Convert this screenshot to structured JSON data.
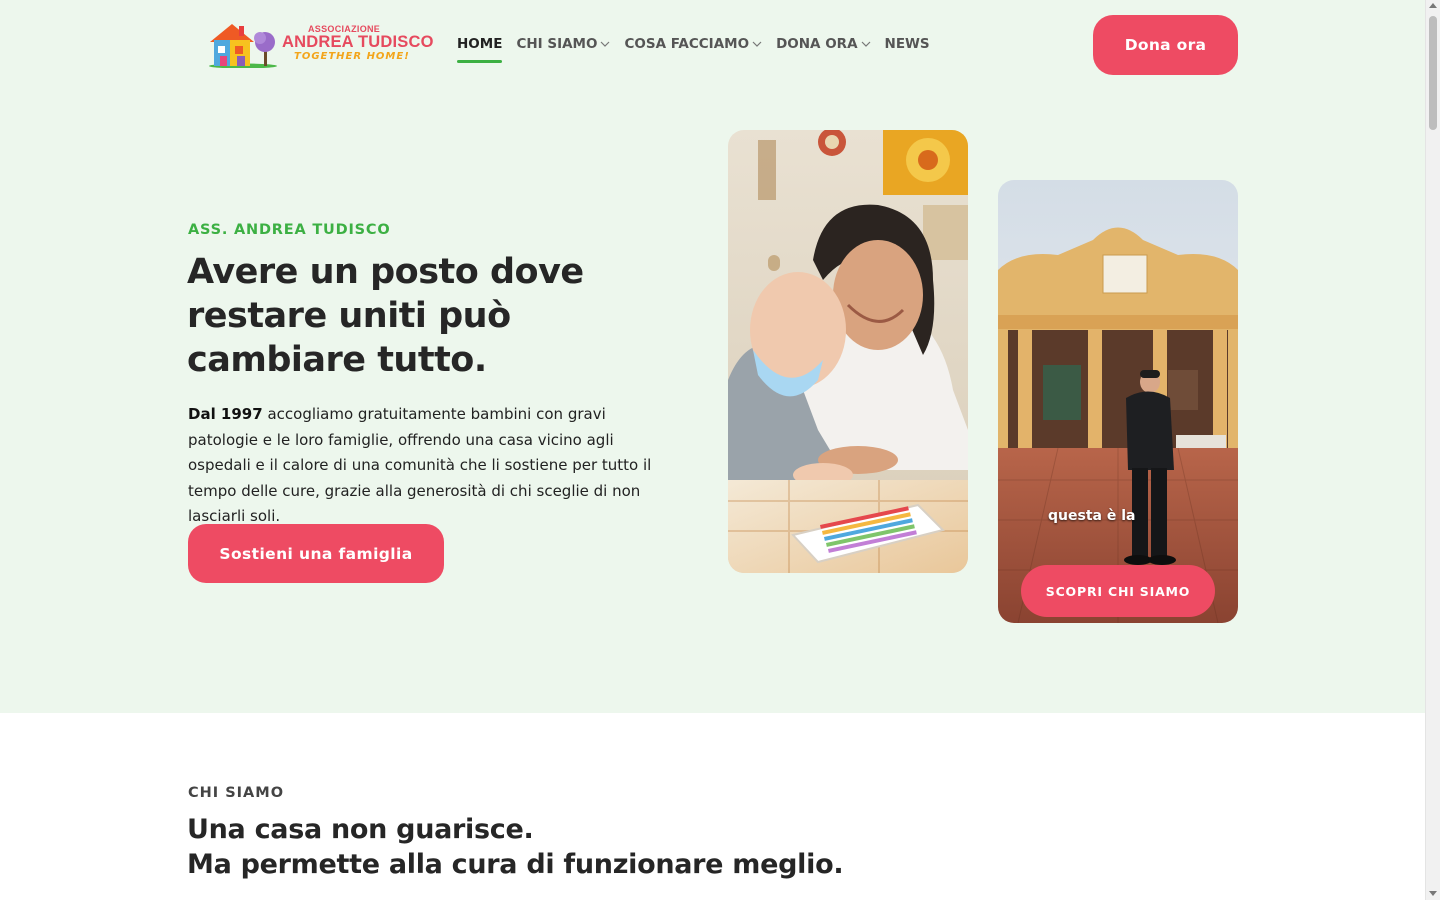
{
  "brand": {
    "line_small": "ASSOCIAZIONE",
    "line_main": "ANDREA TUDISCO",
    "tagline": "TOGETHER HOME!"
  },
  "nav": {
    "items": [
      {
        "label": "HOME",
        "active": true,
        "dropdown": false
      },
      {
        "label": "CHI SIAMO",
        "active": false,
        "dropdown": true
      },
      {
        "label": "COSA FACCIAMO",
        "active": false,
        "dropdown": true
      },
      {
        "label": "DONA ORA",
        "active": false,
        "dropdown": true
      },
      {
        "label": "NEWS",
        "active": false,
        "dropdown": false
      }
    ],
    "cta_label": "Dona ora"
  },
  "hero": {
    "eyebrow": "ASS. ANDREA TUDISCO",
    "headline": "Avere un posto dove restare uniti può cambiare tutto.",
    "intro_bold": "Dal 1997",
    "intro_rest": " accogliamo gratuitamente bambini con gravi patologie e le loro famiglie, offrendo una casa vicino agli ospedali e il calore di una comunità che li sostiene per tutto il tempo delle cure, grazie alla generosità di chi sceglie di non lasciarli soli.",
    "cta_label": "Sostieni una famiglia"
  },
  "video_card": {
    "caption": "questa è la",
    "cta_label": "SCOPRI CHI SIAMO"
  },
  "about": {
    "eyebrow": "CHI SIAMO",
    "title_line1": "Una casa non guarisce.",
    "title_line2": "Ma permette alla cura di funzionare meglio."
  },
  "colors": {
    "accent": "#ee4b63",
    "green": "#3cb043",
    "hero_bg": "#edf7ed"
  }
}
